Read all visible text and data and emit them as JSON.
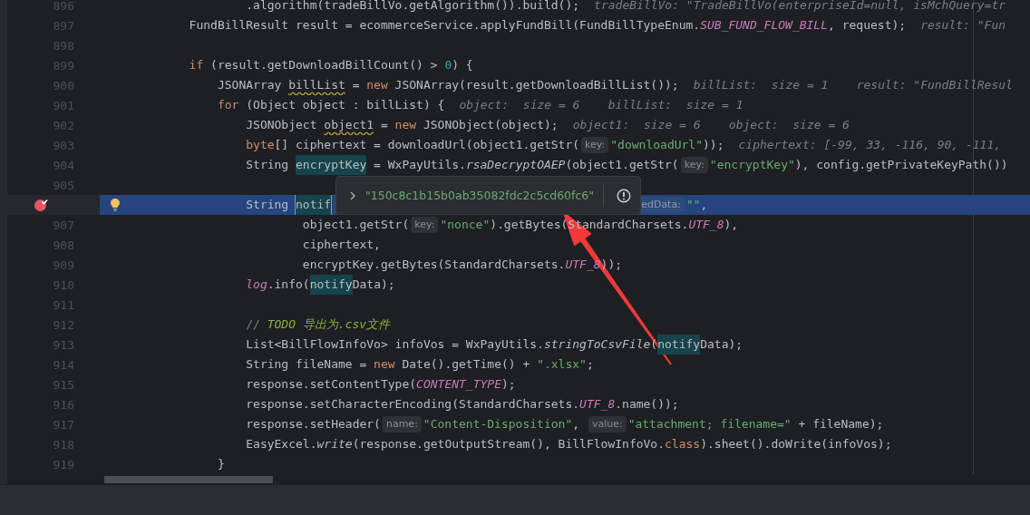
{
  "editor": {
    "lines": [
      {
        "number": "896",
        "breakpoint": false,
        "bulb": false,
        "current": false,
        "tokens": [
          {
            "kind": "plain",
            "text": "                .algorithm(tradeBillVo.getAlgorithm()).build();"
          },
          {
            "kind": "hint",
            "text": "tradeBillVo: \"TradeBillVo(enterpriseId=null, isMchQuery=tr"
          }
        ]
      },
      {
        "number": "897",
        "breakpoint": false,
        "bulb": false,
        "current": false,
        "tokens": [
          {
            "kind": "plain",
            "text": "        FundBillResult result = ecommerceService.applyFundBill(FundBillTypeEnum."
          },
          {
            "kind": "const",
            "text": "SUB_FUND_FLOW_BILL"
          },
          {
            "kind": "plain",
            "text": ", request);"
          },
          {
            "kind": "hint",
            "text": "result: \"Fun"
          }
        ]
      },
      {
        "number": "898",
        "breakpoint": false,
        "bulb": false,
        "current": false
      },
      {
        "number": "899",
        "breakpoint": false,
        "bulb": false,
        "current": false,
        "tokens": [
          {
            "kind": "kw",
            "text": "        if"
          },
          {
            "kind": "plain",
            "text": " (result.getDownloadBillCount() > "
          },
          {
            "kind": "num",
            "text": "0"
          },
          {
            "kind": "plain",
            "text": ") {"
          }
        ]
      },
      {
        "number": "900",
        "breakpoint": false,
        "bulb": false,
        "current": false,
        "tokens": [
          {
            "kind": "plain",
            "text": "            JSONArray "
          },
          {
            "kind": "warn",
            "text": "billList"
          },
          {
            "kind": "plain",
            "text": " = "
          },
          {
            "kind": "kw",
            "text": "new"
          },
          {
            "kind": "plain",
            "text": " JSONArray(result.getDownloadBillList());"
          },
          {
            "kind": "hint",
            "text": "billList:  size = 1    result: \"FundBillResul"
          }
        ]
      },
      {
        "number": "901",
        "breakpoint": false,
        "bulb": false,
        "current": false,
        "tokens": [
          {
            "kind": "kw",
            "text": "            for"
          },
          {
            "kind": "plain",
            "text": " (Object object : billList) {"
          },
          {
            "kind": "hint",
            "text": "object:  size = 6    billList:  size = 1"
          }
        ]
      },
      {
        "number": "902",
        "breakpoint": false,
        "bulb": false,
        "current": false,
        "tokens": [
          {
            "kind": "plain",
            "text": "                JSONObject "
          },
          {
            "kind": "warn",
            "text": "object1"
          },
          {
            "kind": "plain",
            "text": " = "
          },
          {
            "kind": "kw",
            "text": "new"
          },
          {
            "kind": "plain",
            "text": " JSONObject(object);"
          },
          {
            "kind": "hint",
            "text": "object1:  size = 6    object:  size = 6"
          }
        ]
      },
      {
        "number": "903",
        "breakpoint": false,
        "bulb": false,
        "current": false,
        "tokens": [
          {
            "kind": "kw",
            "text": "                byte"
          },
          {
            "kind": "plain",
            "text": "[] ciphertext = downloadUrl(object1.getStr("
          },
          {
            "kind": "pill",
            "text": "key:"
          },
          {
            "kind": "str",
            "text": "\"downloadUrl\""
          },
          {
            "kind": "plain",
            "text": "));"
          },
          {
            "kind": "hint",
            "text": "ciphertext: [-99, 33, -116, 90, -111,"
          }
        ]
      },
      {
        "number": "904",
        "breakpoint": false,
        "bulb": false,
        "current": false,
        "tokens": [
          {
            "kind": "plain",
            "text": "                String "
          },
          {
            "kind": "usage",
            "text": "encryptKey"
          },
          {
            "kind": "plain",
            "text": " = WxPayUtils."
          },
          {
            "kind": "static",
            "text": "rsaDecryptOAEP"
          },
          {
            "kind": "plain",
            "text": "(object1.getStr("
          },
          {
            "kind": "pill",
            "text": "key:"
          },
          {
            "kind": "str",
            "text": "\"encryptKey\""
          },
          {
            "kind": "plain",
            "text": "), config.getPrivateKeyPath())"
          }
        ]
      },
      {
        "number": "905",
        "breakpoint": false,
        "bulb": false,
        "current": false
      },
      {
        "breakpoint": true,
        "bulb": true,
        "current": true,
        "tokens": [
          {
            "kind": "plain",
            "text": "                String "
          },
          {
            "kind": "usage_write",
            "text": "notif"
          },
          {
            "kind": "pill_cut",
            "text": "edData:"
          },
          {
            "kind": "str",
            "text": "\"\""
          },
          {
            "kind": "plain",
            "text": ","
          }
        ]
      },
      {
        "number": "907",
        "breakpoint": false,
        "bulb": false,
        "current": false,
        "tokens": [
          {
            "kind": "plain",
            "text": "                        object1.getStr("
          },
          {
            "kind": "pill",
            "text": "key:"
          },
          {
            "kind": "str",
            "text": "\"nonce\""
          },
          {
            "kind": "plain",
            "text": ").getBytes(StandardCharsets."
          },
          {
            "kind": "const",
            "text": "UTF_8"
          },
          {
            "kind": "plain",
            "text": "),"
          }
        ]
      },
      {
        "number": "908",
        "breakpoint": false,
        "bulb": false,
        "current": false,
        "tokens": [
          {
            "kind": "plain",
            "text": "                        ciphertext,"
          }
        ]
      },
      {
        "number": "909",
        "breakpoint": false,
        "bulb": false,
        "current": false,
        "tokens": [
          {
            "kind": "plain",
            "text": "                        encryptKey.getBytes(StandardCharsets."
          },
          {
            "kind": "const",
            "text": "UTF_8"
          },
          {
            "kind": "plain",
            "text": "));"
          }
        ]
      },
      {
        "number": "910",
        "breakpoint": false,
        "bulb": false,
        "current": false,
        "tokens": [
          {
            "kind": "const",
            "text": "                log"
          },
          {
            "kind": "plain",
            "text": ".info("
          },
          {
            "kind": "usage",
            "text": "notify"
          },
          {
            "kind": "plain",
            "text": "Data);"
          }
        ]
      },
      {
        "number": "911",
        "breakpoint": false,
        "bulb": false,
        "current": false
      },
      {
        "number": "912",
        "breakpoint": false,
        "bulb": false,
        "current": false,
        "tokens": [
          {
            "kind": "comment",
            "text": "                // "
          },
          {
            "kind": "todo",
            "text": "TODO 导出为.csv文件"
          }
        ]
      },
      {
        "number": "913",
        "breakpoint": false,
        "bulb": false,
        "current": false,
        "tokens": [
          {
            "kind": "plain",
            "text": "                List<BillFlowInfoVo> infoVos = WxPayUtils."
          },
          {
            "kind": "static",
            "text": "stringToCsvFile"
          },
          {
            "kind": "plain",
            "text": "("
          },
          {
            "kind": "usage",
            "text": "notify"
          },
          {
            "kind": "plain",
            "text": "Data);"
          }
        ]
      },
      {
        "number": "914",
        "breakpoint": false,
        "bulb": false,
        "current": false,
        "tokens": [
          {
            "kind": "plain",
            "text": "                String fileName = "
          },
          {
            "kind": "kw",
            "text": "new"
          },
          {
            "kind": "plain",
            "text": " Date().getTime() + "
          },
          {
            "kind": "str",
            "text": "\".xlsx\""
          },
          {
            "kind": "plain",
            "text": ";"
          }
        ]
      },
      {
        "number": "915",
        "breakpoint": false,
        "bulb": false,
        "current": false,
        "tokens": [
          {
            "kind": "plain",
            "text": "                response.setContentType("
          },
          {
            "kind": "const",
            "text": "CONTENT_TYPE"
          },
          {
            "kind": "plain",
            "text": ");"
          }
        ]
      },
      {
        "number": "916",
        "breakpoint": false,
        "bulb": false,
        "current": false,
        "tokens": [
          {
            "kind": "plain",
            "text": "                response.setCharacterEncoding(StandardCharsets."
          },
          {
            "kind": "const",
            "text": "UTF_8"
          },
          {
            "kind": "plain",
            "text": ".name());"
          }
        ]
      },
      {
        "number": "917",
        "breakpoint": false,
        "bulb": false,
        "current": false,
        "tokens": [
          {
            "kind": "plain",
            "text": "                response.setHeader("
          },
          {
            "kind": "pill",
            "text": "name:"
          },
          {
            "kind": "str",
            "text": "\"Content-Disposition\""
          },
          {
            "kind": "plain",
            "text": ", "
          },
          {
            "kind": "pill",
            "text": "value:"
          },
          {
            "kind": "str",
            "text": "\"attachment; filename=\""
          },
          {
            "kind": "plain",
            "text": " + fileName);"
          }
        ]
      },
      {
        "number": "918",
        "breakpoint": false,
        "bulb": false,
        "current": false,
        "tokens": [
          {
            "kind": "plain",
            "text": "                EasyExcel."
          },
          {
            "kind": "static",
            "text": "write"
          },
          {
            "kind": "plain",
            "text": "(response.getOutputStream(), BillFlowInfoVo."
          },
          {
            "kind": "kw",
            "text": "class"
          },
          {
            "kind": "plain",
            "text": ").sheet().doWrite(infoVos);"
          }
        ]
      },
      {
        "number": "919",
        "breakpoint": false,
        "bulb": false,
        "current": false,
        "tokens": [
          {
            "kind": "plain",
            "text": "            }"
          }
        ]
      }
    ]
  },
  "value_popup": {
    "value": "\"150c8c1b15b0ab35082fdc2c5cd60fc6\""
  }
}
